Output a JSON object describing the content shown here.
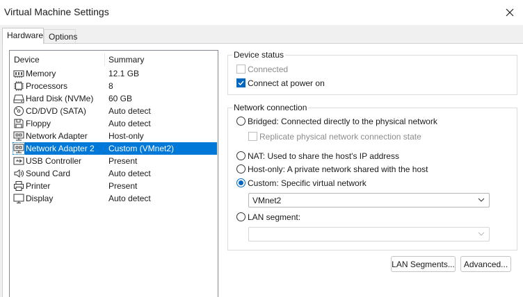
{
  "window": {
    "title": "Virtual Machine Settings"
  },
  "tabs": [
    {
      "label": "Hardware",
      "active": true
    },
    {
      "label": "Options",
      "active": false
    }
  ],
  "device_list": {
    "headers": {
      "device": "Device",
      "summary": "Summary"
    },
    "rows": [
      {
        "name": "Memory",
        "summary": "12.1 GB",
        "icon": "memory-icon"
      },
      {
        "name": "Processors",
        "summary": "8",
        "icon": "processor-icon"
      },
      {
        "name": "Hard Disk (NVMe)",
        "summary": "60 GB",
        "icon": "hard-disk-icon"
      },
      {
        "name": "CD/DVD (SATA)",
        "summary": "Auto detect",
        "icon": "cd-dvd-icon"
      },
      {
        "name": "Floppy",
        "summary": "Auto detect",
        "icon": "floppy-icon"
      },
      {
        "name": "Network Adapter",
        "summary": "Host-only",
        "icon": "network-adapter-icon"
      },
      {
        "name": "Network Adapter 2",
        "summary": "Custom (VMnet2)",
        "icon": "network-adapter-icon",
        "selected": true
      },
      {
        "name": "USB Controller",
        "summary": "Present",
        "icon": "usb-icon"
      },
      {
        "name": "Sound Card",
        "summary": "Auto detect",
        "icon": "speaker-icon"
      },
      {
        "name": "Printer",
        "summary": "Present",
        "icon": "printer-icon"
      },
      {
        "name": "Display",
        "summary": "Auto detect",
        "icon": "display-icon"
      }
    ]
  },
  "device_status": {
    "label": "Device status",
    "connected": {
      "label": "Connected",
      "checked": false,
      "disabled": true
    },
    "connect_at_power_on": {
      "label": "Connect at power on",
      "checked": true
    }
  },
  "network_connection": {
    "label": "Network connection",
    "bridged": {
      "label": "Bridged: Connected directly to the physical network",
      "checked": false
    },
    "replicate": {
      "label": "Replicate physical network connection state",
      "checked": false,
      "disabled": true
    },
    "nat": {
      "label": "NAT: Used to share the host's IP address",
      "checked": false
    },
    "host_only": {
      "label": "Host-only: A private network shared with the host",
      "checked": false
    },
    "custom": {
      "label": "Custom: Specific virtual network",
      "checked": true
    },
    "custom_select": {
      "value": "VMnet2"
    },
    "lan_segment": {
      "label": "LAN segment:",
      "checked": false
    },
    "lan_select": {
      "value": ""
    }
  },
  "buttons": {
    "lan_segments": "LAN Segments...",
    "advanced": "Advanced..."
  },
  "colors": {
    "selection": "#0078d7",
    "accent": "#0067c0"
  }
}
